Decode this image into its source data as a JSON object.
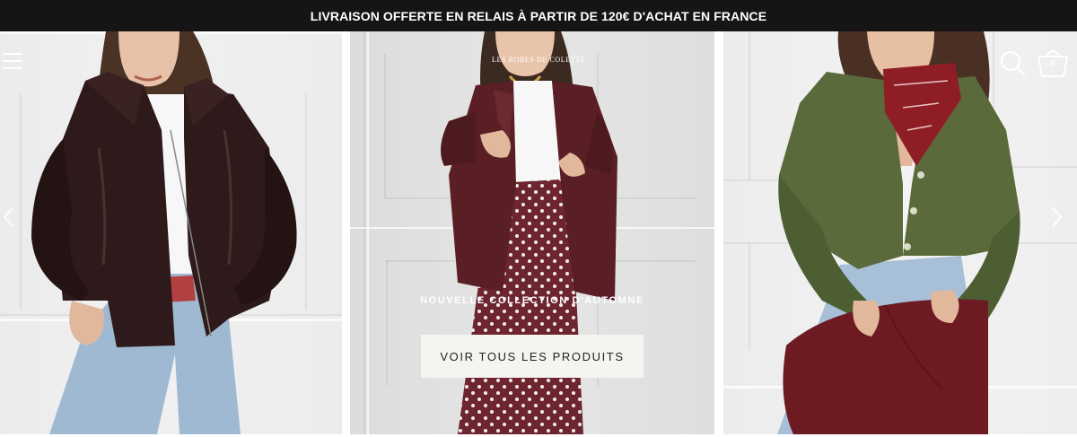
{
  "announcement": {
    "text": "LIVRAISON OFFERTE EN RELAIS À PARTIR DE 120€ D'ACHAT EN FRANCE"
  },
  "header": {
    "logo_text": "LES ROBES DE COLETTE",
    "cart_count": "0",
    "icons": [
      "hamburger-menu-icon",
      "search-icon",
      "basket-icon"
    ]
  },
  "slider": {
    "prev_icon": "chevron-left-icon",
    "next_icon": "chevron-right-icon"
  },
  "hero": {
    "collection_title": "NOUVELLE COLLECTION D'AUTOMNE",
    "cta_label": "VOIR TOUS LES PRODUITS"
  },
  "colors": {
    "announcement_bg": "#151515",
    "announcement_text": "#ffffff",
    "cta_bg": "#f5f4f0",
    "cta_text": "#222222"
  }
}
